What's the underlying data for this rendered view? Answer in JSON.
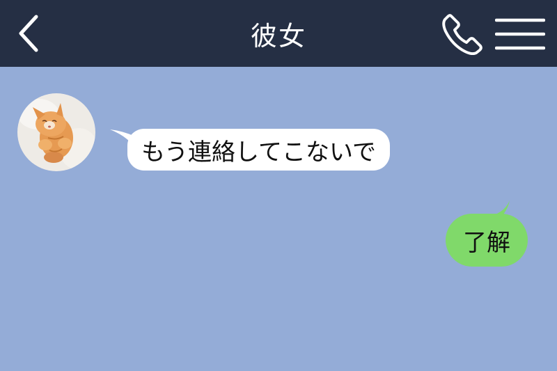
{
  "header": {
    "title": "彼女",
    "back_icon": "chevron-left-icon",
    "call_icon": "phone-icon",
    "menu_icon": "hamburger-menu-icon"
  },
  "messages": [
    {
      "direction": "incoming",
      "text": "もう連絡してこないで"
    },
    {
      "direction": "outgoing",
      "text": "了解"
    }
  ],
  "colors": {
    "header_bg": "#252f44",
    "chat_bg": "#94acd7",
    "incoming_bubble": "#ffffff",
    "outgoing_bubble": "#80d96a"
  }
}
